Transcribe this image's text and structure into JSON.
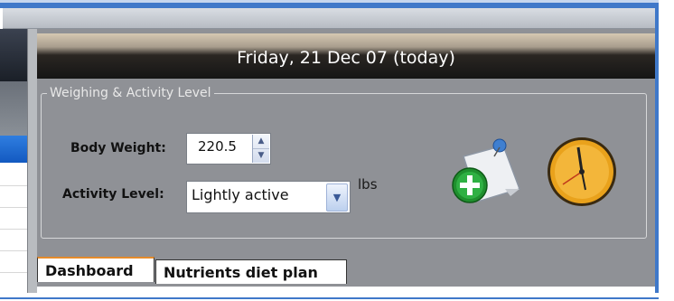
{
  "date_header": "Friday, 21 Dec 07 (today)",
  "weighing_group": {
    "title": "Weighing & Activity Level",
    "body_weight_label": "Body Weight:",
    "body_weight_value": "220.5",
    "activity_label": "Activity Level:",
    "activity_value": "Lightly active",
    "unit": "lbs"
  },
  "icons": {
    "add_entry": "add-note-icon",
    "clock": "clock-icon",
    "spin_up": "chevron-up-icon",
    "spin_down": "chevron-down-icon",
    "dropdown": "chevron-down-icon"
  },
  "tabs": [
    {
      "label": "Dashboard",
      "active": true
    },
    {
      "label": "Nutrients diet plan",
      "active": false
    }
  ],
  "colors": {
    "accent": "#3f78c9",
    "tab_highlight": "#e58b2b",
    "panel": "#8f9196"
  }
}
